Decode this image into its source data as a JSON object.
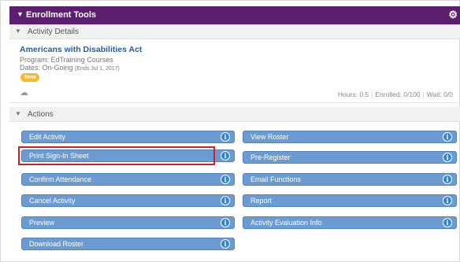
{
  "header": {
    "title": "Enrollment Tools",
    "gear_icon": "gear-icon"
  },
  "activity_details": {
    "section_label": "Activity Details",
    "title": "Americans with Disabilities Act",
    "program": "Program: EdTraining Courses",
    "dates_label": "Dates: On-Going",
    "dates_note": "(Ends Jul 1, 2017)",
    "badge": "New",
    "cloud_icon": "cloud-icon",
    "stats": {
      "hours": "Hours: 0.5",
      "enrolled": "Enrolled: 0/100",
      "wait": "Wait: 0/0"
    }
  },
  "actions": {
    "section_label": "Actions",
    "left": [
      "Edit Activity",
      "Print Sign-In Sheet",
      "Confirm Attendance",
      "Cancel Activity",
      "Preview",
      "Download Roster"
    ],
    "right": [
      "View Roster",
      "Pre-Register",
      "Email Functions",
      "Report",
      "Activity Evaluation Info"
    ],
    "info_glyph": "i"
  },
  "colors": {
    "header": "#5c1f6f",
    "button": "#6b9bd1",
    "info": "#2e85d9",
    "highlight": "#d11f25",
    "link": "#1f5da8",
    "badge": "#f5b82e"
  }
}
